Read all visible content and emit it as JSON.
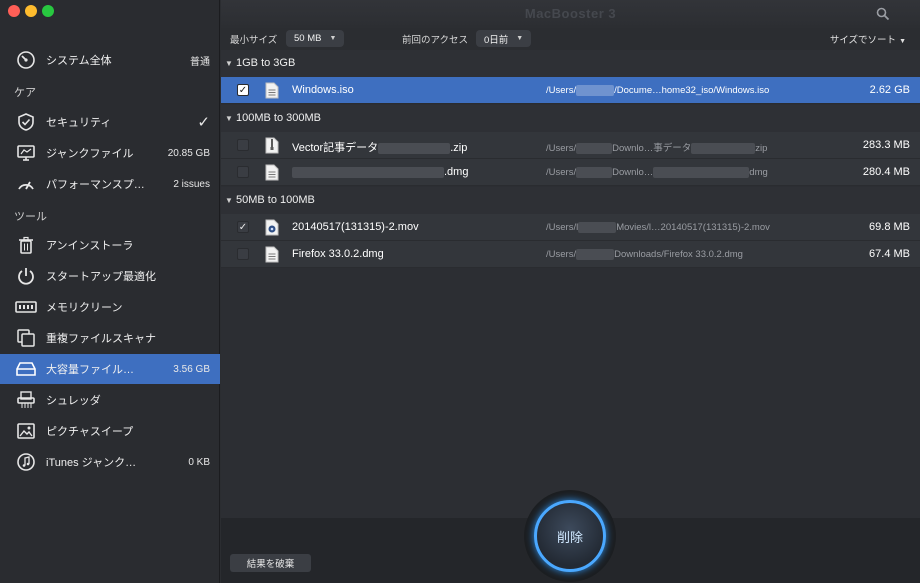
{
  "app": {
    "title": "MacBooster 3"
  },
  "sidebar": {
    "items": [
      {
        "label": "システム全体",
        "value": "普通",
        "icon": "gauge-icon"
      },
      {
        "label": "セキュリティ",
        "value": "✓",
        "icon": "shield-icon"
      },
      {
        "label": "ジャンクファイル",
        "value": "20.85 GB",
        "icon": "junk-icon"
      },
      {
        "label": "パフォーマンスプ…",
        "value": "2 issues",
        "icon": "speedometer-icon"
      },
      {
        "label": "アンインストーラ",
        "value": "",
        "icon": "trash-icon"
      },
      {
        "label": "スタートアップ最適化",
        "value": "",
        "icon": "power-icon"
      },
      {
        "label": "メモリクリーン",
        "value": "",
        "icon": "memory-icon"
      },
      {
        "label": "重複ファイルスキャナ",
        "value": "",
        "icon": "duplicate-icon"
      },
      {
        "label": "大容量ファイル…",
        "value": "3.56 GB",
        "icon": "drive-icon"
      },
      {
        "label": "シュレッダ",
        "value": "",
        "icon": "shredder-icon"
      },
      {
        "label": "ピクチャスイープ",
        "value": "",
        "icon": "picture-icon"
      },
      {
        "label": "iTunes ジャンク…",
        "value": "0 KB",
        "icon": "music-icon"
      }
    ],
    "sections": {
      "care": "ケア",
      "tools": "ツール"
    }
  },
  "filters": {
    "min_size_label": "最小サイズ",
    "min_size_value": "50 MB",
    "last_access_label": "前回のアクセス",
    "last_access_value": "0日前",
    "sort_label": "サイズでソート"
  },
  "groups": [
    {
      "title": "1GB to 3GB",
      "files": [
        {
          "name": "Windows.iso",
          "path_prefix": "/Users/",
          "path_suffix": "/Docume…home32_iso/Windows.iso",
          "size": "2.62 GB",
          "checked": true,
          "selected": true
        }
      ]
    },
    {
      "title": "100MB to 300MB",
      "files": [
        {
          "name": "Vector記事データ",
          "name_suffix": ".zip",
          "path_prefix": "/Users/",
          "path_mid": "Downlo…事データ",
          "path_suffix": "zip",
          "size": "283.3 MB",
          "checked": false
        },
        {
          "name": "",
          "name_suffix": ".dmg",
          "path_prefix": "/Users/",
          "path_mid": "Downlo…",
          "path_suffix": "dmg",
          "size": "280.4 MB",
          "checked": false
        }
      ]
    },
    {
      "title": "50MB to 100MB",
      "files": [
        {
          "name": "20140517(131315)-2.mov",
          "path_prefix": "/Users/l",
          "path_suffix": "Movies/l…20140517(131315)-2.mov",
          "size": "69.8 MB",
          "checked": true
        },
        {
          "name": "Firefox 33.0.2.dmg",
          "path_prefix": "/Users/",
          "path_suffix": "Downloads/Firefox 33.0.2.dmg",
          "size": "67.4 MB",
          "checked": false
        }
      ]
    }
  ],
  "actions": {
    "discard": "結果を破棄",
    "delete": "削除"
  },
  "colors": {
    "accent": "#3e6fc0",
    "delete_ring": "#4aa8ff"
  }
}
